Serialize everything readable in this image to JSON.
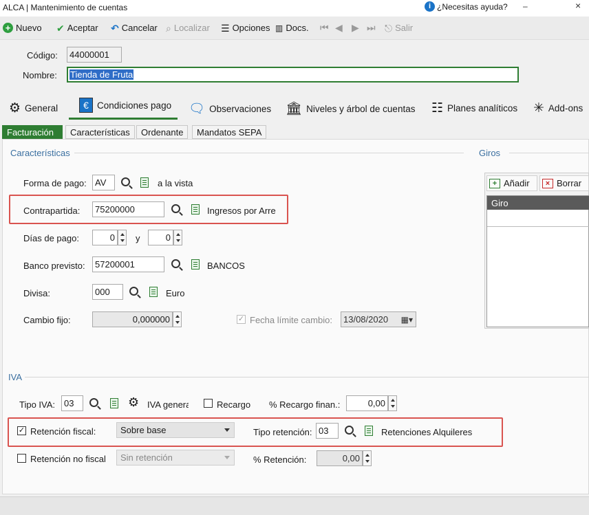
{
  "window": {
    "title": "ALCA | Mantenimiento de cuentas",
    "help": "¿Necesitas ayuda?",
    "minimize": "–",
    "close": "×"
  },
  "toolbar": {
    "nuevo": "Nuevo",
    "aceptar": "Aceptar",
    "cancelar": "Cancelar",
    "localizar": "Localizar",
    "opciones": "Opciones",
    "docs": "Docs.",
    "salir": "Salir"
  },
  "header": {
    "codigo_label": "Código:",
    "codigo_value": "44000001",
    "nombre_label": "Nombre:",
    "nombre_value": "Tienda de Fruta"
  },
  "main_tabs": [
    "General",
    "Condiciones pago",
    "Observaciones",
    "Niveles y árbol de cuentas",
    "Planes analíticos",
    "Add-ons"
  ],
  "sub_tabs": [
    "Facturación",
    "Características",
    "Ordenante",
    "Mandatos SEPA"
  ],
  "caracteristicas": {
    "title": "Características",
    "forma_pago": {
      "label": "Forma de pago:",
      "value": "AV",
      "desc": "a la vista"
    },
    "contrapartida": {
      "label": "Contrapartida:",
      "value": "75200000",
      "desc": "Ingresos por Arre"
    },
    "dias_pago": {
      "label": "Días de pago:",
      "value1": "0",
      "sep": "y",
      "value2": "0"
    },
    "banco": {
      "label": "Banco previsto:",
      "value": "57200001",
      "desc": "BANCOS"
    },
    "divisa": {
      "label": "Divisa:",
      "value": "000",
      "desc": "Euro"
    },
    "cambio_fijo": {
      "label": "Cambio fijo:",
      "value": "0,000000"
    },
    "fecha_limite": {
      "label": "Fecha límite cambio:",
      "value": "13/08/2020",
      "checked": true
    }
  },
  "giros": {
    "title": "Giros",
    "add": "Añadir",
    "delete": "Borrar",
    "column": "Giro"
  },
  "iva": {
    "title": "IVA",
    "tipo_label": "Tipo IVA:",
    "tipo_value": "03",
    "tipo_desc": "IVA genera",
    "recargo_label": "Recargo",
    "pct_recargo_label": "% Recargo finan.:",
    "pct_recargo_value": "0,00",
    "retencion_label": "Retención fiscal:",
    "retencion_checked": true,
    "retencion_select": "Sobre base",
    "tipo_ret_label": "Tipo retención:",
    "tipo_ret_value": "03",
    "tipo_ret_desc": "Retenciones Alquileres",
    "ret_no_fiscal_label": "Retención no fiscal",
    "ret_no_fiscal_select": "Sin retención",
    "pct_ret_label": "% Retención:",
    "pct_ret_value": "0,00"
  },
  "colors": {
    "accent": "#2e7d32",
    "highlight": "#d9534f",
    "section": "#3a6fa0"
  }
}
